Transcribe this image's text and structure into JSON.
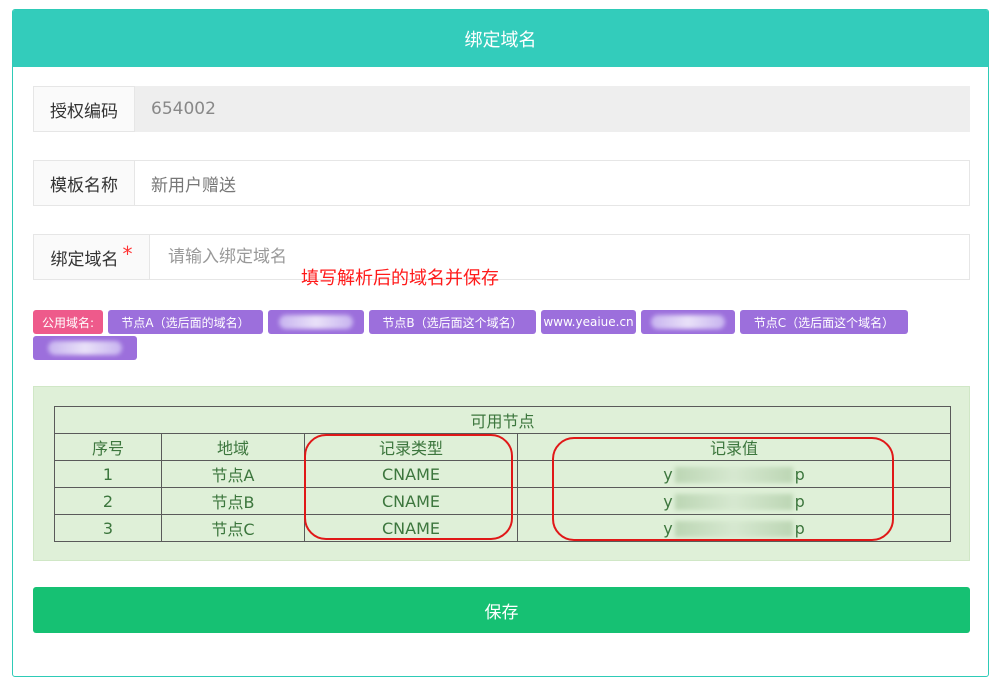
{
  "header": {
    "title": "绑定域名"
  },
  "form": {
    "auth_code": {
      "label": "授权编码",
      "value": "654002"
    },
    "template_name": {
      "label": "模板名称",
      "value": "新用户赠送"
    },
    "bind_domain": {
      "label": "绑定域名",
      "required_mark": "*",
      "placeholder": "请输入绑定域名"
    }
  },
  "annotation": "填写解析后的域名并保存",
  "public_domains": {
    "label": "公用域名:",
    "tags": [
      "节点A（选后面的域名）",
      "节点B（选后面这个域名）",
      "www.yeaiue.cn",
      "节点C（选后面这个域名）"
    ]
  },
  "nodes_table": {
    "caption": "可用节点",
    "headers": [
      "序号",
      "地域",
      "记录类型",
      "记录值"
    ],
    "rows": [
      {
        "index": "1",
        "region": "节点A",
        "type": "CNAME",
        "value_prefix": "y",
        "value_suffix": "p"
      },
      {
        "index": "2",
        "region": "节点B",
        "type": "CNAME",
        "value_prefix": "y",
        "value_suffix": "p"
      },
      {
        "index": "3",
        "region": "节点C",
        "type": "CNAME",
        "value_prefix": "y",
        "value_suffix": "p"
      }
    ]
  },
  "save_button": {
    "label": "保存"
  },
  "colors": {
    "header_bg": "#33ccbb",
    "save_bg": "#16c173",
    "tag_pink": "#ee5a8b",
    "tag_purple": "#9c6fdc",
    "table_text": "#3c763d",
    "annotation_red": "#ff1a1a"
  }
}
